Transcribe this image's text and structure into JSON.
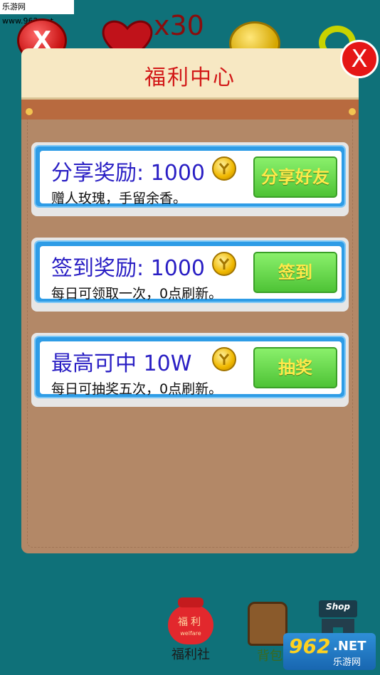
{
  "watermark": {
    "top_text": "乐游网 www.962.net",
    "bottom_brand": "962",
    "bottom_net": ".NET",
    "bottom_name": "乐游网"
  },
  "hud": {
    "lives_count": "x30"
  },
  "dialog": {
    "title": "福利中心",
    "close_label": "X"
  },
  "rewards": [
    {
      "title": "分享奖励: 1000",
      "desc": "赠人玫瑰，手留余香。",
      "button": "分享好友"
    },
    {
      "title": "签到奖励: 1000",
      "desc": "每日可领取一次，0点刷新。",
      "button": "签到"
    },
    {
      "title": "最高可中  10W",
      "desc": "每日可抽奖五次，0点刷新。",
      "button": "抽奖"
    }
  ],
  "nav": {
    "welfare": {
      "label": "福利社",
      "bag_text": "福利",
      "bag_sub": "welfare"
    },
    "backpack": {
      "label": "背包"
    },
    "shop": {
      "sign": "Shop"
    }
  },
  "colors": {
    "background": "#0f7179",
    "title_red": "#d21818",
    "card_blue": "#2e9ce6",
    "button_green": "#4ec336",
    "button_text": "#ffe94a",
    "reward_text": "#2a1fc4"
  }
}
